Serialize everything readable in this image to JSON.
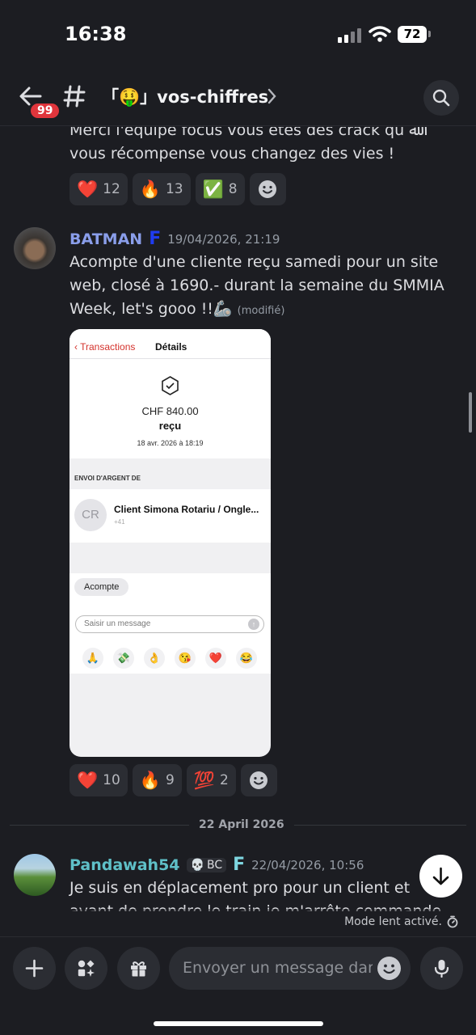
{
  "status_bar": {
    "time": "16:38",
    "battery": "72"
  },
  "header": {
    "back_badge": "99",
    "channel_name": "「🤑」vos-chiffres",
    "search_icon": "search-icon"
  },
  "messages": {
    "continued": {
      "text": "Merci l'équipe focus vous êtes des crack qu ﷲ vous récompense vous changez des vies !",
      "reactions": [
        {
          "emoji": "❤️",
          "count": "12"
        },
        {
          "emoji": "🔥",
          "count": "13"
        },
        {
          "emoji": "✅",
          "count": "8"
        }
      ]
    },
    "batman": {
      "author": "BATMAN",
      "author_color": "#8a9eea",
      "flair": "F",
      "flair_color": "#1f3cf0",
      "timestamp": "19/04/2026, 21:19",
      "text": "Acompte d'une cliente reçu samedi pour un site web, closé à 1690.- durant la semaine du SMMIA Week, let's gooo !!🦾",
      "edited": "(modifié)",
      "attachment": {
        "back_link": "Transactions",
        "title": "Détails",
        "amount": "CHF 840.00",
        "state": "reçu",
        "date": "18 avr. 2026 à 18:19",
        "section": "ENVOI D'ARGENT DE",
        "contact_initials": "CR",
        "contact_name": "Client Simona Rotariu / Ongle...",
        "contact_number": "+41",
        "chat_bubble": "Acompte",
        "input_placeholder": "Saisir un message",
        "quick_emojis": [
          "🙏",
          "💸",
          "👌",
          "😘",
          "❤️",
          "😂"
        ]
      },
      "reactions": [
        {
          "emoji": "❤️",
          "count": "10"
        },
        {
          "emoji": "🔥",
          "count": "9"
        },
        {
          "emoji": "💯",
          "count": "2"
        }
      ]
    },
    "date_divider": "22 April 2026",
    "pandawah": {
      "author": "Pandawah54",
      "author_color": "#5fc0c8",
      "tag": "BC",
      "flair": "F",
      "flair_color": "#7ed6e0",
      "timestamp": "22/04/2026, 10:56",
      "text": "Je suis en déplacement pro pour un client et avant de prendre le train je m'arrête commande je vois il a pas"
    }
  },
  "slow_mode": "Mode lent activé.",
  "composer": {
    "placeholder": "Envoyer un message dan..",
    "buttons": [
      "plus-icon",
      "apps-icon",
      "gift-icon",
      "mic-icon"
    ]
  }
}
